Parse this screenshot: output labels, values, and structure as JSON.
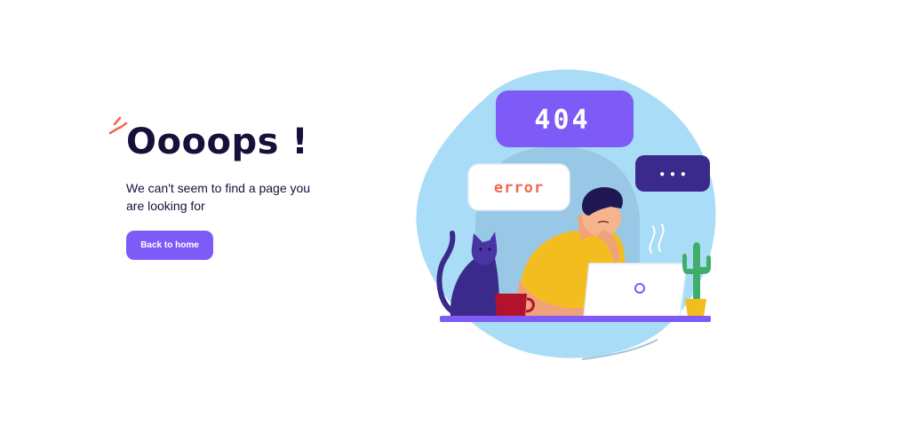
{
  "page": {
    "title": "Oooops !",
    "message": "We can't seem to find a page you are looking for",
    "back_button_label": "Back to home"
  },
  "illustration": {
    "code_bubble_text": "404",
    "error_bubble_text": "error",
    "typing_bubble_text": "• • •"
  },
  "colors": {
    "accent": "#7e5bf6",
    "dark_text": "#15113a",
    "error_text": "#f06a4e",
    "blob": "#a9dcf6",
    "shirt": "#f4bd1f",
    "cat": "#3a2a8c",
    "cactus": "#3fae6a",
    "mug": "#b3122d"
  },
  "icons": [
    "burst-icon",
    "cat-icon",
    "mug-icon",
    "laptop-icon",
    "cactus-icon",
    "steam-icon"
  ]
}
